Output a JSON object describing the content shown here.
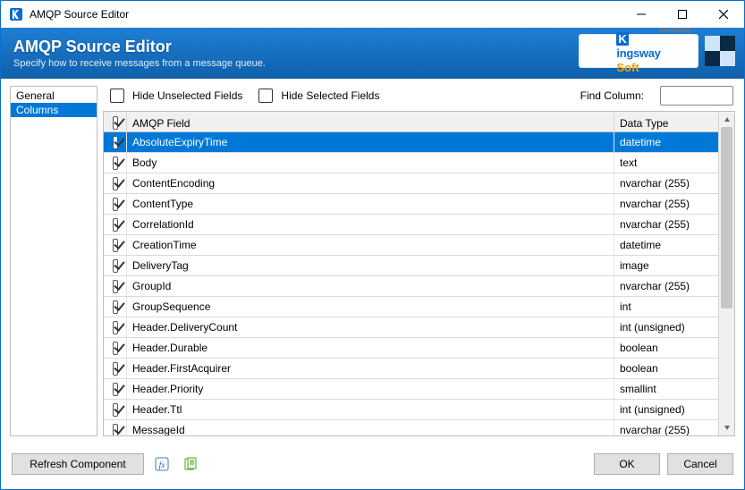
{
  "window": {
    "title": "AMQP Source Editor"
  },
  "banner": {
    "heading": "AMQP Source Editor",
    "subtitle": "Specify how to receive messages from a message queue.",
    "powered_by_small": "Powered By",
    "brand_k": "K",
    "brand_ingsway": "ingsway",
    "brand_soft": "Soft"
  },
  "nav": {
    "items": [
      {
        "label": "General",
        "selected": false
      },
      {
        "label": "Columns",
        "selected": true
      }
    ]
  },
  "toolbar": {
    "hide_unselected_label": "Hide Unselected Fields",
    "hide_unselected_checked": false,
    "hide_selected_label": "Hide Selected Fields",
    "hide_selected_checked": false,
    "find_label": "Find Column:",
    "find_value": ""
  },
  "grid": {
    "header_field": "AMQP Field",
    "header_type": "Data Type",
    "header_checked": true,
    "rows": [
      {
        "checked": true,
        "field": "AbsoluteExpiryTime",
        "type": "datetime",
        "selected": true
      },
      {
        "checked": true,
        "field": "Body",
        "type": "text",
        "selected": false
      },
      {
        "checked": true,
        "field": "ContentEncoding",
        "type": "nvarchar (255)",
        "selected": false
      },
      {
        "checked": true,
        "field": "ContentType",
        "type": "nvarchar (255)",
        "selected": false
      },
      {
        "checked": true,
        "field": "CorrelationId",
        "type": "nvarchar (255)",
        "selected": false
      },
      {
        "checked": true,
        "field": "CreationTime",
        "type": "datetime",
        "selected": false
      },
      {
        "checked": true,
        "field": "DeliveryTag",
        "type": "image",
        "selected": false
      },
      {
        "checked": true,
        "field": "GroupId",
        "type": "nvarchar (255)",
        "selected": false
      },
      {
        "checked": true,
        "field": "GroupSequence",
        "type": "int",
        "selected": false
      },
      {
        "checked": true,
        "field": "Header.DeliveryCount",
        "type": "int (unsigned)",
        "selected": false
      },
      {
        "checked": true,
        "field": "Header.Durable",
        "type": "boolean",
        "selected": false
      },
      {
        "checked": true,
        "field": "Header.FirstAcquirer",
        "type": "boolean",
        "selected": false
      },
      {
        "checked": true,
        "field": "Header.Priority",
        "type": "smallint",
        "selected": false
      },
      {
        "checked": true,
        "field": "Header.Ttl",
        "type": "int (unsigned)",
        "selected": false
      },
      {
        "checked": true,
        "field": "MessageId",
        "type": "nvarchar (255)",
        "selected": false
      }
    ]
  },
  "footer": {
    "refresh_label": "Refresh Component",
    "ok_label": "OK",
    "cancel_label": "Cancel"
  }
}
